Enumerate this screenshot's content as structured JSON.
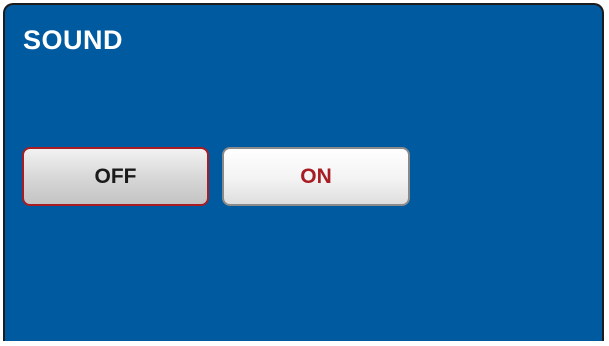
{
  "window": {
    "title": "SOUND"
  },
  "sound_toggle": {
    "options": [
      {
        "label": "OFF",
        "selected": true
      },
      {
        "label": "ON",
        "selected": false
      }
    ]
  },
  "colors": {
    "panel_background": "#005aa0",
    "panel_border": "#1c1c1c",
    "title_text": "#ffffff",
    "selected_border": "#a71d23",
    "unselected_text": "#a71d23",
    "selected_text": "#1a1a1a"
  }
}
